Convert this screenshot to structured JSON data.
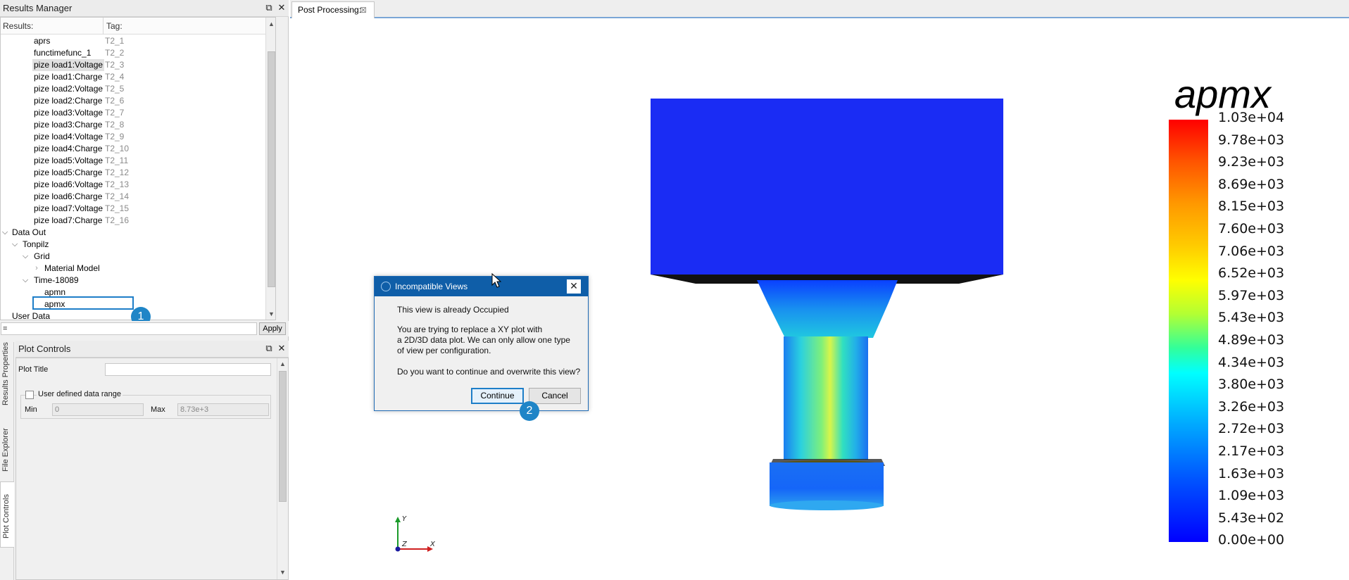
{
  "results_manager": {
    "title": "Results Manager",
    "col_results": "Results:",
    "col_tag": "Tag:",
    "rows": [
      {
        "label": "aprs",
        "tag": "T2_1"
      },
      {
        "label": "functimefunc_1",
        "tag": "T2_2"
      },
      {
        "label": "pize load1:Voltage",
        "tag": "T2_3"
      },
      {
        "label": "pize load1:Charge",
        "tag": "T2_4"
      },
      {
        "label": "pize load2:Voltage",
        "tag": "T2_5"
      },
      {
        "label": "pize load2:Charge",
        "tag": "T2_6"
      },
      {
        "label": "pize load3:Voltage",
        "tag": "T2_7"
      },
      {
        "label": "pize load3:Charge",
        "tag": "T2_8"
      },
      {
        "label": "pize load4:Voltage",
        "tag": "T2_9"
      },
      {
        "label": "pize load4:Charge",
        "tag": "T2_10"
      },
      {
        "label": "pize load5:Voltage",
        "tag": "T2_11"
      },
      {
        "label": "pize load5:Charge",
        "tag": "T2_12"
      },
      {
        "label": "pize load6:Voltage",
        "tag": "T2_13"
      },
      {
        "label": "pize load6:Charge",
        "tag": "T2_14"
      },
      {
        "label": "pize load7:Voltage",
        "tag": "T2_15"
      },
      {
        "label": "pize load7:Charge",
        "tag": "T2_16"
      }
    ],
    "tree": {
      "data_out": "Data Out",
      "tonpilz": "Tonpilz",
      "grid": "Grid",
      "material_model": "Material Model",
      "time": "Time-18089",
      "apmn": "apmn",
      "apmx": "apmx",
      "user_data": "User Data"
    },
    "filter_value": "=",
    "apply_label": "Apply",
    "badge_1": "1"
  },
  "side_tabs": {
    "results_properties": "Results Properties",
    "file_explorer": "File Explorer",
    "plot_controls": "Plot Controls"
  },
  "plot_controls": {
    "title": "Plot Controls",
    "plot_title_label": "Plot Title",
    "plot_title_value": "",
    "user_range_label": "User defined data range",
    "min_label": "Min",
    "min_value": "0",
    "max_label": "Max",
    "max_value": "8.73e+3"
  },
  "document_tab": {
    "label": "Post Processing:"
  },
  "legend": {
    "title": "apmx",
    "ticks": [
      "1.03e+04",
      "9.78e+03",
      "9.23e+03",
      "8.69e+03",
      "8.15e+03",
      "7.60e+03",
      "7.06e+03",
      "6.52e+03",
      "5.97e+03",
      "5.43e+03",
      "4.89e+03",
      "4.34e+03",
      "3.80e+03",
      "3.26e+03",
      "2.72e+03",
      "2.17e+03",
      "1.63e+03",
      "1.09e+03",
      "5.43e+02",
      "0.00e+00"
    ]
  },
  "axes": {
    "y": "Y",
    "x": "X",
    "z": "Z"
  },
  "dialog": {
    "title": "Incompatible Views",
    "line1": "This view is already Occupied",
    "line2": "You are trying to replace a XY plot with",
    "line3": "a 2D/3D data plot. We can only allow one type",
    "line4": "of view per configuration.",
    "line5": "Do you want to continue and overwrite this view?",
    "continue_label": "Continue",
    "cancel_label": "Cancel",
    "badge_2": "2"
  }
}
